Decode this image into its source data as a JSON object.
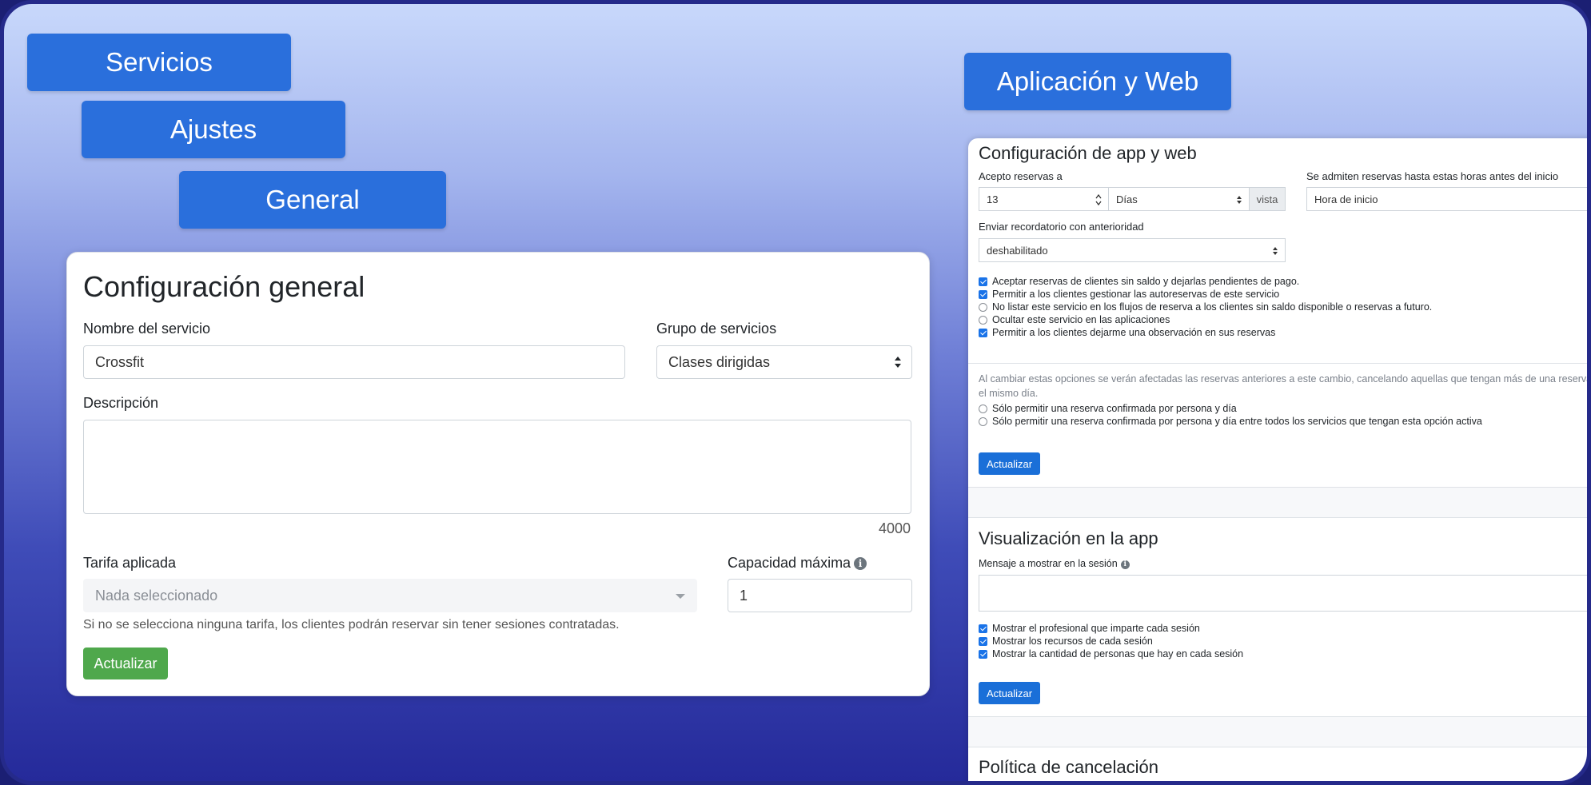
{
  "breadcrumbs": {
    "servicios": "Servicios",
    "ajustes": "Ajustes",
    "general": "General",
    "app_web": "Aplicación y Web"
  },
  "general": {
    "title": "Configuración general",
    "service_name_label": "Nombre del servicio",
    "service_name_value": "Crossfit",
    "group_label": "Grupo de servicios",
    "group_value": "Clases dirigidas",
    "description_label": "Descripción",
    "description_value": "",
    "description_counter": "4000",
    "rate_label": "Tarifa aplicada",
    "rate_placeholder": "Nada seleccionado",
    "capacity_label": "Capacidad máxima",
    "capacity_value": "1",
    "rate_help": "Si no se selecciona ninguna tarifa, los clientes podrán reservar sin tener sesiones contratadas.",
    "update_button": "Actualizar"
  },
  "app_config": {
    "title": "Configuración de app y web",
    "accept_label": "Acepto reservas a",
    "accept_value": "13",
    "accept_unit": "Días",
    "accept_addon": "vista",
    "hours_label": "Se admiten reservas hasta estas horas antes del inicio",
    "hours_value": "Hora de inicio",
    "reminder_label": "Enviar recordatorio con anterioridad",
    "reminder_value": "deshabilitado",
    "options": [
      {
        "label": "Aceptar reservas de clientes sin saldo y dejarlas pendientes de pago.",
        "checked": true
      },
      {
        "label": "Permitir a los clientes gestionar las autoreservas de este servicio",
        "checked": true
      },
      {
        "label": "No listar este servicio en los flujos de reserva a los clientes sin saldo disponible o reservas a futuro.",
        "checked": false
      },
      {
        "label": "Ocultar este servicio en las aplicaciones",
        "checked": false
      },
      {
        "label": "Permitir a los clientes dejarme una observación en sus reservas",
        "checked": true
      }
    ],
    "note": "Al cambiar estas opciones se verán afectadas las reservas anteriores a este cambio, cancelando aquellas que tengan más de una reserva en el mismo día.",
    "limits": [
      {
        "label": "Sólo permitir una reserva confirmada por persona y día",
        "checked": false
      },
      {
        "label": "Sólo permitir una reserva confirmada por persona y día entre todos los servicios que tengan esta opción activa",
        "checked": false
      }
    ],
    "update_button": "Actualizar"
  },
  "app_view": {
    "title": "Visualización en la app",
    "message_label": "Mensaje a mostrar en la sesión",
    "message_value": "",
    "options": [
      {
        "label": "Mostrar el profesional que imparte cada sesión",
        "checked": true
      },
      {
        "label": "Mostrar los recursos de cada sesión",
        "checked": true
      },
      {
        "label": "Mostrar la cantidad de personas que hay en cada sesión",
        "checked": true
      }
    ],
    "update_button": "Actualizar"
  },
  "cancel_policy": {
    "title": "Política de cancelación"
  },
  "colors": {
    "primary": "#2a6fdc",
    "success": "#4fa84c",
    "checkbox": "#1a73e8"
  }
}
